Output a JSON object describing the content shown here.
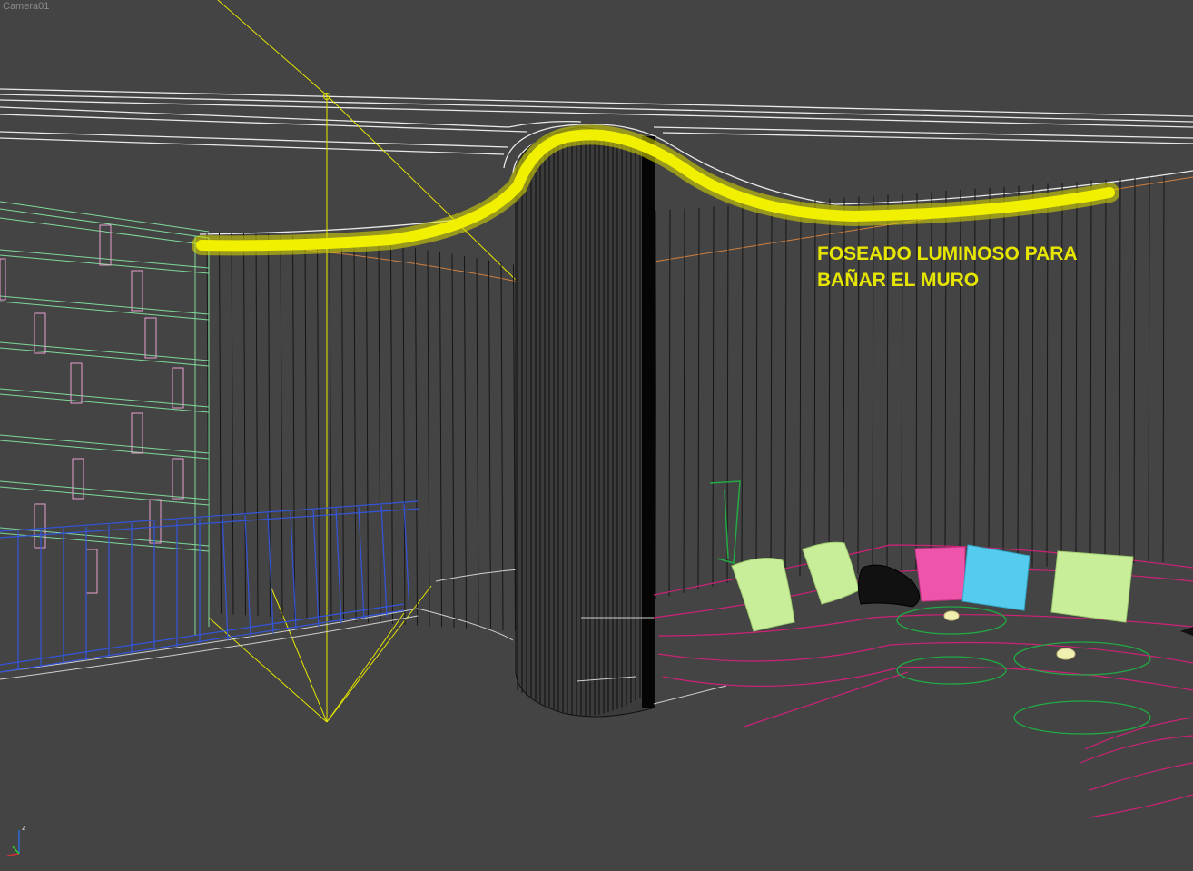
{
  "viewport": {
    "label": "Camera01",
    "background": "#444444"
  },
  "annotation": {
    "line1": "FOSEADO LUMINOSO PARA",
    "line2": "BAÑAR EL MURO",
    "color": "#e6e600"
  },
  "axis_gizmo": {
    "z_label": "z",
    "icon": "axis-tripod-icon"
  },
  "colors": {
    "ceiling_lines": "#e8e8e8",
    "light_target": "#e6e600",
    "shelves": "#7fd99a",
    "railing": "#3355dd",
    "sofa": "#cc2277",
    "tables": "#22aa44",
    "column": "#111111",
    "glow": "#f0f000"
  }
}
